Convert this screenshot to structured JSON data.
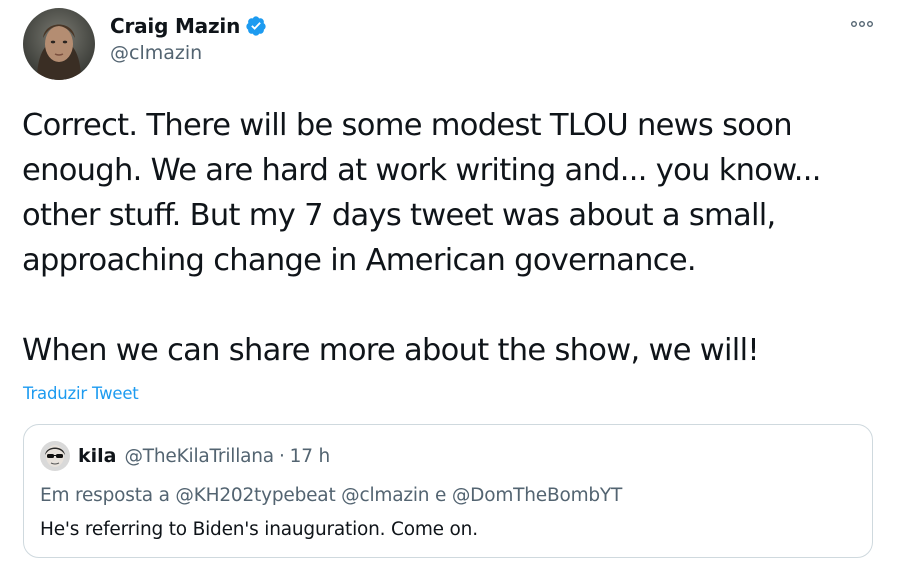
{
  "author": {
    "name": "Craig Mazin",
    "handle": "@clmazin",
    "verified": true
  },
  "tweet": {
    "paragraphs": [
      "Correct. There will be some modest TLOU news soon enough. We are hard at work writing and... you know... other stuff. But my 7 days tweet was about a small, approaching change in American governance.",
      "When we can share more about the show, we will!"
    ],
    "translate_label": "Traduzir Tweet"
  },
  "quoted": {
    "name": "kila",
    "handle": "@TheKilaTrillana",
    "separator": "·",
    "time": "17 h",
    "reply_line": "Em resposta a @KH202typebeat @clmazin e @DomTheBombYT",
    "text": "He's referring to Biden's inauguration. Come on."
  },
  "icons": {
    "verified": "verified-badge-icon",
    "more": "more-options-icon"
  },
  "colors": {
    "accent": "#1d9bf0",
    "secondary_text": "#536471",
    "primary_text": "#0f1419",
    "border": "#cfd9de"
  }
}
